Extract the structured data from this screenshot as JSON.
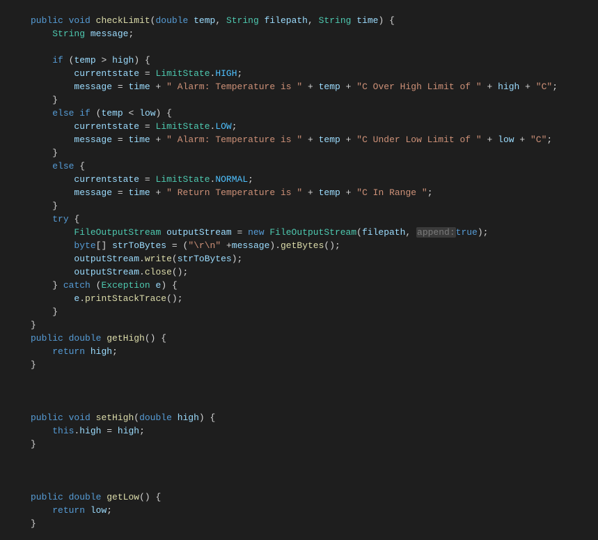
{
  "kw": {
    "public": "public",
    "void": "void",
    "double": "double",
    "if": "if",
    "else": "else",
    "try": "try",
    "catch": "catch",
    "new": "new",
    "return": "return",
    "this": "this",
    "true": "true",
    "byte": "byte"
  },
  "types": {
    "String": "String",
    "LimitState": "LimitState",
    "FileOutputStream": "FileOutputStream",
    "Exception": "Exception"
  },
  "fns": {
    "checkLimit": "checkLimit",
    "getBytes": "getBytes",
    "write": "write",
    "close": "close",
    "printStackTrace": "printStackTrace",
    "getHigh": "getHigh",
    "setHigh": "setHigh",
    "getLow": "getLow"
  },
  "vars": {
    "temp": "temp",
    "filepath": "filepath",
    "time": "time",
    "message": "message",
    "currentstate": "currentstate",
    "high": "high",
    "low": "low",
    "outputStream": "outputStream",
    "strToBytes": "strToBytes",
    "e": "e"
  },
  "consts": {
    "HIGH": "HIGH",
    "LOW": "LOW",
    "NORMAL": "NORMAL"
  },
  "strs": {
    "alarmTemp": "\" Alarm: Temperature is \"",
    "overHigh": "\"C Over High Limit of \"",
    "underLow": "\"C Under Low Limit of \"",
    "c": "\"C\"",
    "returnTemp": "\" Return Temperature is \"",
    "inRange": "\"C In Range \"",
    "crlf": "\"\\r\\n\""
  },
  "hint": {
    "append": "append:"
  }
}
